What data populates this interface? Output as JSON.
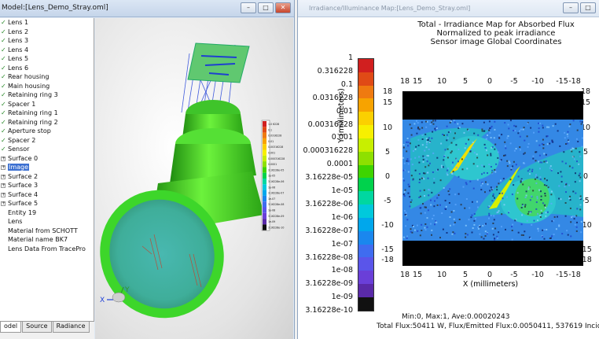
{
  "left_window": {
    "title": "Model:[Lens_Demo_Stray.oml]",
    "buttons": {
      "minimize": "–",
      "restore": "□",
      "close": "✕"
    },
    "tree": [
      {
        "label": "Lens 1",
        "mark": "check"
      },
      {
        "label": "Lens 2",
        "mark": "check"
      },
      {
        "label": "Lens 3",
        "mark": "check"
      },
      {
        "label": "Lens 4",
        "mark": "check"
      },
      {
        "label": "Lens 5",
        "mark": "check"
      },
      {
        "label": "Lens 6",
        "mark": "check"
      },
      {
        "label": "Rear housing",
        "mark": "check"
      },
      {
        "label": "Main housing",
        "mark": "check"
      },
      {
        "label": "Retaining ring 3",
        "mark": "check"
      },
      {
        "label": "Spacer 1",
        "mark": "check"
      },
      {
        "label": "Retaining ring 1",
        "mark": "check"
      },
      {
        "label": "Retaining ring 2",
        "mark": "check"
      },
      {
        "label": "Aperture stop",
        "mark": "check"
      },
      {
        "label": "Spacer 2",
        "mark": "check"
      },
      {
        "label": "Sensor",
        "mark": "check"
      },
      {
        "label": "Surface 0",
        "mark": "expand"
      },
      {
        "label": "Image",
        "mark": "expand",
        "selected": true
      },
      {
        "label": "Surface 2",
        "mark": "expand"
      },
      {
        "label": "Surface 3",
        "mark": "expand"
      },
      {
        "label": "Surface 4",
        "mark": "expand"
      },
      {
        "label": "Surface 5",
        "mark": "expand"
      },
      {
        "label": "Entity 19",
        "mark": "none"
      },
      {
        "label": "Lens",
        "mark": "none"
      },
      {
        "label": "Material from SCHOTT",
        "mark": "none"
      },
      {
        "label": "Material name BK7",
        "mark": "none"
      },
      {
        "label": "Lens Data From TracePro",
        "mark": "none"
      }
    ],
    "tabs": [
      "odel",
      "Source",
      "Radiance"
    ],
    "axis_labels": {
      "x": "X",
      "y": "Y"
    }
  },
  "right_window": {
    "title": "Irradiance/Illuminance Map:[Lens_Demo_Stray.oml]",
    "buttons": {
      "minimize": "–",
      "restore": "□"
    },
    "map_title": [
      "Total - Irradiance Map for Absorbed Flux",
      "Normalized to peak irradiance",
      "Sensor image    Global Coordinates"
    ],
    "colorbar": {
      "labels": [
        "1",
        "0.316228",
        "0.1",
        "0.0316228",
        "0.01",
        "0.00316228",
        "0.001",
        "0.000316228",
        "0.0001",
        "3.16228e-05",
        "1e-05",
        "3.16228e-06",
        "1e-06",
        "3.16228e-07",
        "1e-07",
        "3.16228e-08",
        "1e-08",
        "3.16228e-09",
        "1e-09",
        "3.16228e-10"
      ],
      "colors": [
        "#d11f1f",
        "#e04a16",
        "#ef7a10",
        "#f7a300",
        "#fbd000",
        "#f7f000",
        "#c8ef00",
        "#8ee000",
        "#3ed400",
        "#00d24c",
        "#00d7a0",
        "#00c9dc",
        "#00a7ec",
        "#1a87ee",
        "#3f6cf0",
        "#5a55ea",
        "#6a3fd8",
        "#5a2aa8",
        "#111111"
      ]
    },
    "x_ticks": [
      "18",
      "15",
      "10",
      "5",
      "0",
      "-5",
      "-10",
      "-15",
      "-18"
    ],
    "y_ticks": [
      "18",
      "15",
      "10",
      "5",
      "0",
      "-5",
      "-10",
      "-15",
      "-18"
    ],
    "xlabel": "X (millimeters)",
    "ylabel": "Y (millimeters)",
    "stats": "Min:0, Max:1, Ave:0.00020243",
    "flux": "Total Flux:50411 W, Flux/Emitted Flux:0.0050411, 537619 Incident R"
  },
  "legend3d_labels": [
    "1.0 6228",
    "0.1",
    "0.0316228",
    "0.01",
    "0.00316228",
    "0.001",
    "0.000316228",
    "0.0001",
    "3.16228e-05",
    "1e-05",
    "3.16228e-06",
    "1e-06",
    "3.16228e-07",
    "1e-07",
    "3.16228e-08",
    "1e-08",
    "3.16228e-09",
    "1e-09",
    "3.16228e-10"
  ]
}
